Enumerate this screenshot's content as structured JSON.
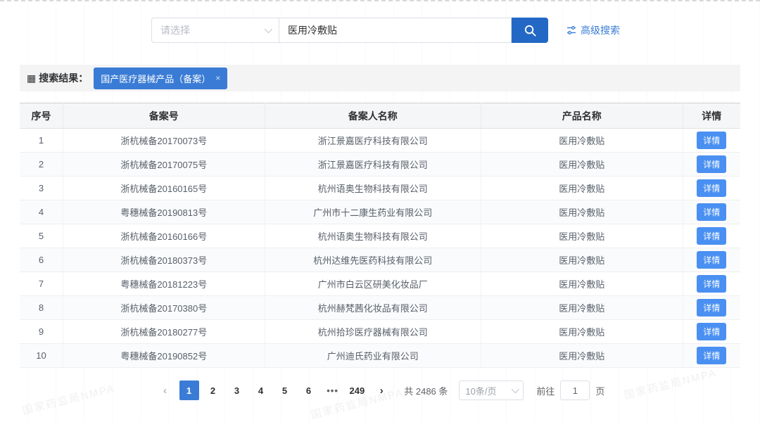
{
  "search": {
    "select_placeholder": "请选择",
    "query_value": "医用冷敷贴",
    "advanced_label": "高级搜索"
  },
  "results": {
    "grid_glyph": "▦",
    "label": "搜索结果：",
    "tag": "国产医疗器械产品（备案）",
    "tag_close": "×"
  },
  "table": {
    "headers": [
      "序号",
      "备案号",
      "备案人名称",
      "产品名称",
      "详情"
    ],
    "detail_label": "详情",
    "rows": [
      {
        "no": "1",
        "record_no": "浙杭械备20170073号",
        "registrant": "浙江景嘉医疗科技有限公司",
        "product": "医用冷敷贴"
      },
      {
        "no": "2",
        "record_no": "浙杭械备20170075号",
        "registrant": "浙江景嘉医疗科技有限公司",
        "product": "医用冷敷贴"
      },
      {
        "no": "3",
        "record_no": "浙杭械备20160165号",
        "registrant": "杭州语奥生物科技有限公司",
        "product": "医用冷敷贴"
      },
      {
        "no": "4",
        "record_no": "粤穗械备20190813号",
        "registrant": "广州市十二康生药业有限公司",
        "product": "医用冷敷贴"
      },
      {
        "no": "5",
        "record_no": "浙杭械备20160166号",
        "registrant": "杭州语奥生物科技有限公司",
        "product": "医用冷敷贴"
      },
      {
        "no": "6",
        "record_no": "浙杭械备20180373号",
        "registrant": "杭州达维先医药科技有限公司",
        "product": "医用冷敷贴"
      },
      {
        "no": "7",
        "record_no": "粤穗械备20181223号",
        "registrant": "广州市白云区研美化妆品厂",
        "product": "医用冷敷贴"
      },
      {
        "no": "8",
        "record_no": "浙杭械备20170380号",
        "registrant": "杭州赫梵茜化妆品有限公司",
        "product": "医用冷敷贴"
      },
      {
        "no": "9",
        "record_no": "浙杭械备20180277号",
        "registrant": "杭州拾珍医疗器械有限公司",
        "product": "医用冷敷贴"
      },
      {
        "no": "10",
        "record_no": "粤穗械备20190852号",
        "registrant": "广州迪氏药业有限公司",
        "product": "医用冷敷贴"
      }
    ]
  },
  "pagination": {
    "prev_glyph": "‹",
    "next_glyph": "›",
    "pages": [
      "1",
      "2",
      "3",
      "4",
      "5",
      "6"
    ],
    "active": "1",
    "ellipsis": "•••",
    "last_page": "249",
    "total_text": "共 2486 条",
    "page_size": "10条/页",
    "goto_prefix": "前往",
    "goto_value": "1",
    "goto_suffix": "页"
  },
  "watermark_text": "国家药监局NMPA",
  "colors": {
    "primary": "#3a7cd5",
    "search-btn": "#2368c4",
    "tag": "#3a7cd5",
    "detail": "#4a90f2"
  }
}
